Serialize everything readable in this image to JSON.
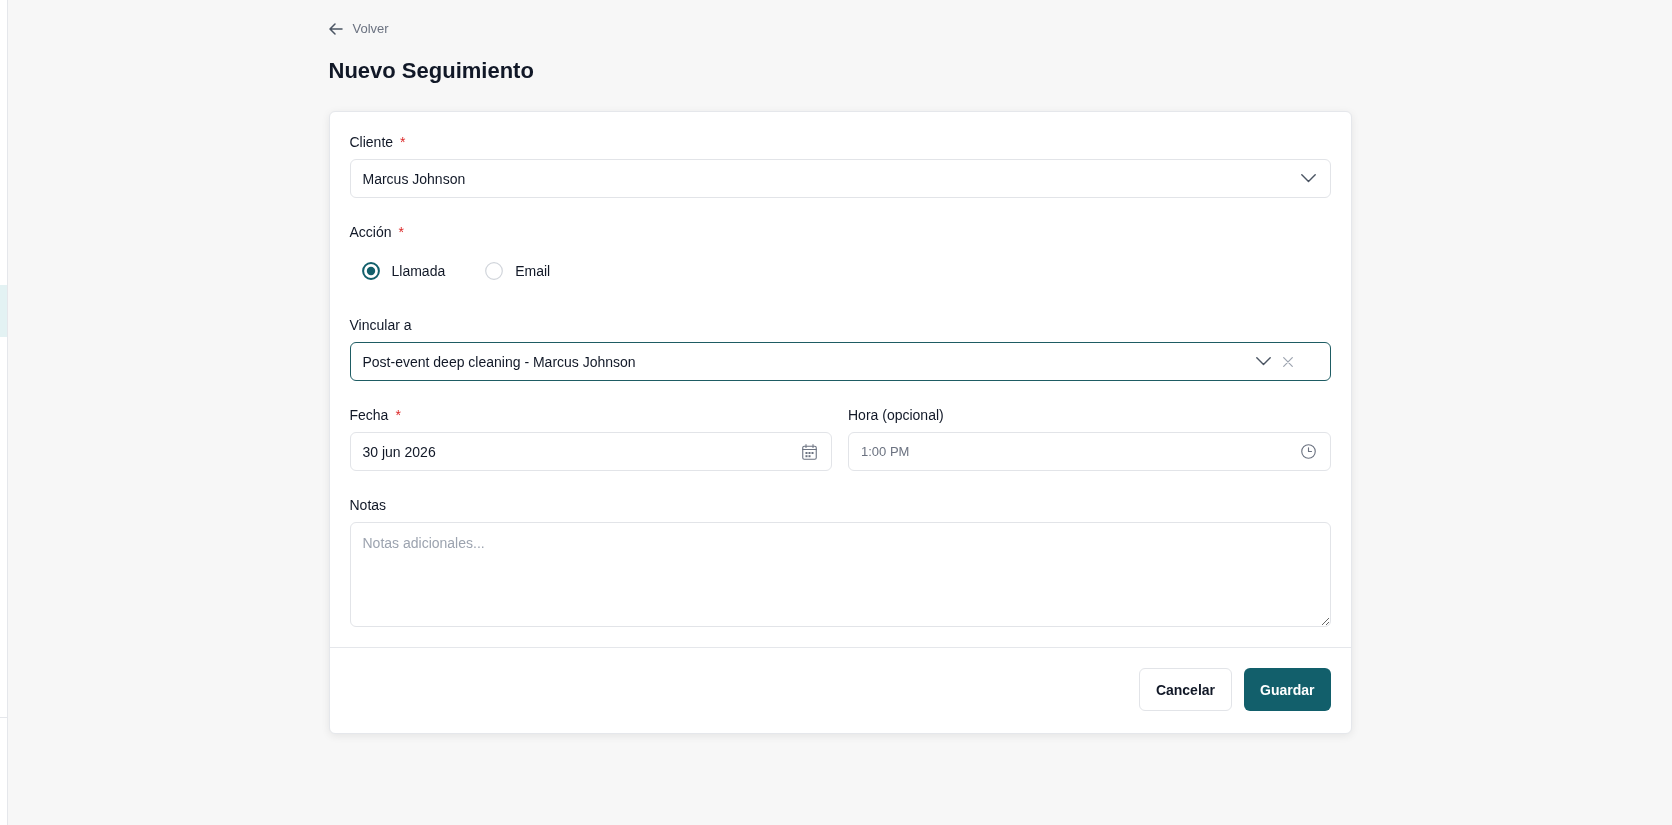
{
  "back_link": {
    "label": "Volver"
  },
  "title": "Nuevo Seguimiento",
  "form": {
    "fields": [
      {
        "kind": "select",
        "label": "Cliente",
        "required_mark": "*",
        "value": "Marcus Johnson",
        "focused": false,
        "clearable": false
      },
      {
        "kind": "radio",
        "label": "Acción",
        "required_mark": "*",
        "options": [
          {
            "label": "Llamada",
            "selected": true
          },
          {
            "label": "Email",
            "selected": false
          }
        ]
      },
      {
        "kind": "select",
        "label": "Vincular a",
        "value": "Post-event deep cleaning - Marcus Johnson",
        "focused": true,
        "clearable": true
      },
      {
        "kind": "row",
        "fields": [
          {
            "kind": "date",
            "label": "Fecha",
            "required_mark": "*",
            "value": "30 jun 2026"
          },
          {
            "kind": "time",
            "label": "Hora (opcional)",
            "placeholder": "1:00 PM"
          }
        ]
      },
      {
        "kind": "textarea",
        "label": "Notas",
        "placeholder": "Notas adicionales..."
      }
    ]
  },
  "buttons": [
    {
      "label": "Cancelar",
      "kind": "secondary"
    },
    {
      "label": "Guardar",
      "kind": "primary"
    }
  ]
}
